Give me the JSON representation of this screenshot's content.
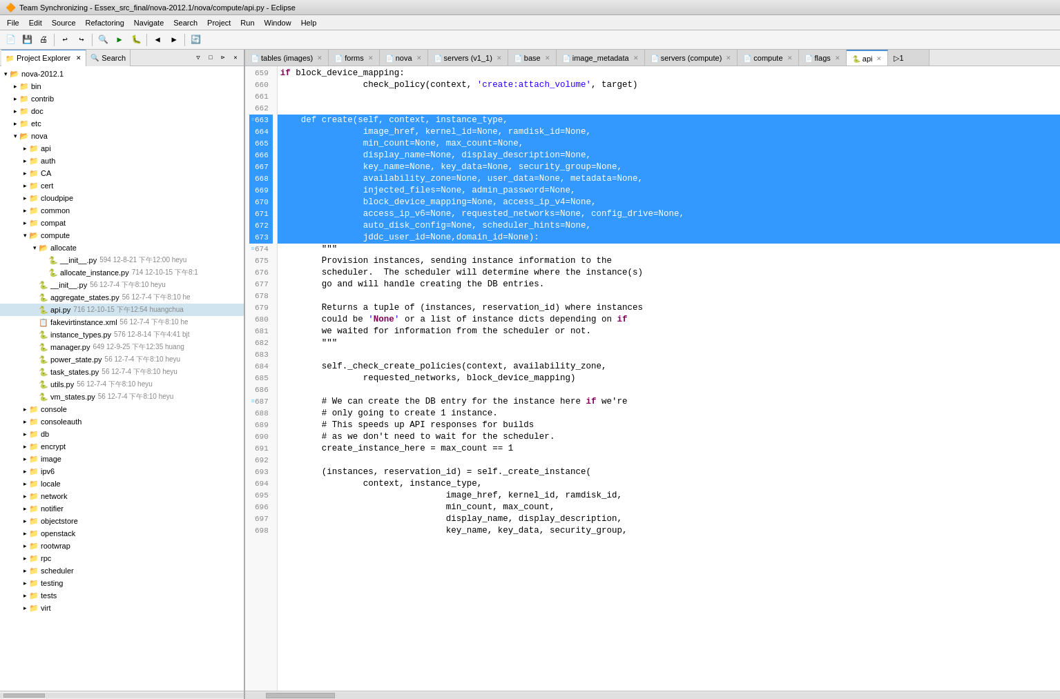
{
  "titleBar": {
    "title": "Team Synchronizing - Essex_src_final/nova-2012.1/nova/compute/api.py - Eclipse",
    "icon": "🔶"
  },
  "menuBar": {
    "items": [
      "File",
      "Edit",
      "Source",
      "Refactoring",
      "Navigate",
      "Search",
      "Project",
      "Run",
      "Window",
      "Help"
    ]
  },
  "leftPanel": {
    "tabs": [
      {
        "label": "Project Explorer",
        "icon": "📁",
        "active": true
      },
      {
        "label": "Search",
        "icon": "🔍",
        "active": false
      }
    ]
  },
  "fileTree": {
    "items": [
      {
        "label": "nova-2012.1",
        "type": "folder",
        "indent": 0,
        "expanded": true
      },
      {
        "label": "bin",
        "type": "folder",
        "indent": 1,
        "expanded": false
      },
      {
        "label": "contrib",
        "type": "folder",
        "indent": 1,
        "expanded": false
      },
      {
        "label": "doc",
        "type": "folder",
        "indent": 1,
        "expanded": false
      },
      {
        "label": "etc",
        "type": "folder",
        "indent": 1,
        "expanded": false
      },
      {
        "label": "nova",
        "type": "folder",
        "indent": 1,
        "expanded": true
      },
      {
        "label": "api",
        "type": "folder",
        "indent": 2,
        "expanded": false
      },
      {
        "label": "auth",
        "type": "folder",
        "indent": 2,
        "expanded": false
      },
      {
        "label": "CA",
        "type": "folder",
        "indent": 2,
        "expanded": false
      },
      {
        "label": "cert",
        "type": "folder",
        "indent": 2,
        "expanded": false
      },
      {
        "label": "cloudpipe",
        "type": "folder",
        "indent": 2,
        "expanded": false
      },
      {
        "label": "common",
        "type": "folder",
        "indent": 2,
        "expanded": false
      },
      {
        "label": "compat",
        "type": "folder",
        "indent": 2,
        "expanded": false
      },
      {
        "label": "compute",
        "type": "folder",
        "indent": 2,
        "expanded": true
      },
      {
        "label": "allocate",
        "type": "folder",
        "indent": 3,
        "expanded": true
      },
      {
        "label": "__init__.py",
        "type": "py",
        "indent": 4,
        "meta": "594  12-8-21  下午12:00  heyu"
      },
      {
        "label": "allocate_instance.py",
        "type": "py",
        "indent": 4,
        "meta": "714  12-10-15  下午8:1"
      },
      {
        "label": "__init__.py",
        "type": "py",
        "indent": 3,
        "meta": "56  12-7-4  下午8:10  heyu"
      },
      {
        "label": "aggregate_states.py",
        "type": "py",
        "indent": 3,
        "meta": "56  12-7-4  下午8:10  he"
      },
      {
        "label": "api.py",
        "type": "py",
        "indent": 3,
        "meta": "716  12-10-15  下午12:54  huangchua",
        "active": true
      },
      {
        "label": "fakevirtinstance.xml",
        "type": "xml",
        "indent": 3,
        "meta": "56  12-7-4  下午8:10  he"
      },
      {
        "label": "instance_types.py",
        "type": "py",
        "indent": 3,
        "meta": "576  12-8-14  下午4:41  bjt"
      },
      {
        "label": "manager.py",
        "type": "py",
        "indent": 3,
        "meta": "649  12-9-25  下午12:35  huang"
      },
      {
        "label": "power_state.py",
        "type": "py",
        "indent": 3,
        "meta": "56  12-7-4  下午8:10  heyu"
      },
      {
        "label": "task_states.py",
        "type": "py",
        "indent": 3,
        "meta": "56  12-7-4  下午8:10  heyu"
      },
      {
        "label": "utils.py",
        "type": "py",
        "indent": 3,
        "meta": "56  12-7-4  下午8:10  heyu"
      },
      {
        "label": "vm_states.py",
        "type": "py",
        "indent": 3,
        "meta": "56  12-7-4  下午8:10  heyu"
      },
      {
        "label": "console",
        "type": "folder",
        "indent": 2,
        "expanded": false
      },
      {
        "label": "consoleauth",
        "type": "folder",
        "indent": 2,
        "expanded": false
      },
      {
        "label": "db",
        "type": "folder",
        "indent": 2,
        "expanded": false
      },
      {
        "label": "encrypt",
        "type": "folder",
        "indent": 2,
        "expanded": false
      },
      {
        "label": "image",
        "type": "folder",
        "indent": 2,
        "expanded": false
      },
      {
        "label": "ipv6",
        "type": "folder",
        "indent": 2,
        "expanded": false
      },
      {
        "label": "locale",
        "type": "folder",
        "indent": 2,
        "expanded": false
      },
      {
        "label": "network",
        "type": "folder",
        "indent": 2,
        "expanded": false
      },
      {
        "label": "notifier",
        "type": "folder",
        "indent": 2,
        "expanded": false
      },
      {
        "label": "objectstore",
        "type": "folder",
        "indent": 2,
        "expanded": false
      },
      {
        "label": "openstack",
        "type": "folder",
        "indent": 2,
        "expanded": false
      },
      {
        "label": "rootwrap",
        "type": "folder",
        "indent": 2,
        "expanded": false
      },
      {
        "label": "rpc",
        "type": "folder",
        "indent": 2,
        "expanded": false
      },
      {
        "label": "scheduler",
        "type": "folder",
        "indent": 2,
        "expanded": false
      },
      {
        "label": "testing",
        "type": "folder",
        "indent": 2,
        "expanded": false
      },
      {
        "label": "tests",
        "type": "folder",
        "indent": 2,
        "expanded": false
      },
      {
        "label": "virt",
        "type": "folder",
        "indent": 2,
        "expanded": false
      }
    ]
  },
  "editorTabs": {
    "tabs": [
      {
        "label": "tables (images)",
        "icon": "📄",
        "active": false
      },
      {
        "label": "forms",
        "icon": "📄",
        "active": false
      },
      {
        "label": "nova",
        "icon": "📄",
        "active": false
      },
      {
        "label": "servers (v1_1)",
        "icon": "📄",
        "active": false
      },
      {
        "label": "base",
        "icon": "📄",
        "active": false
      },
      {
        "label": "image_metadata",
        "icon": "📄",
        "active": false
      },
      {
        "label": "servers (compute)",
        "icon": "📄",
        "active": false
      },
      {
        "label": "compute",
        "icon": "📄",
        "active": false
      },
      {
        "label": "flags",
        "icon": "📄",
        "active": false
      },
      {
        "label": "api",
        "icon": "📄",
        "active": true
      },
      {
        "label": "▷1",
        "icon": "",
        "active": false
      }
    ]
  },
  "codeLines": [
    {
      "num": "659",
      "content": "            if block_device_mapping:",
      "selected": false
    },
    {
      "num": "660",
      "content": "                check_policy(context, 'create:attach_volume', target)",
      "selected": false,
      "hasString": true
    },
    {
      "num": "661",
      "content": "",
      "selected": false
    },
    {
      "num": "662",
      "content": "",
      "selected": false
    },
    {
      "num": "663",
      "content": "    def create(self, context, instance_type,",
      "selected": true
    },
    {
      "num": "664",
      "content": "                image_href, kernel_id=None, ramdisk_id=None,",
      "selected": true
    },
    {
      "num": "665",
      "content": "                min_count=None, max_count=None,",
      "selected": true
    },
    {
      "num": "666",
      "content": "                display_name=None, display_description=None,",
      "selected": true
    },
    {
      "num": "667",
      "content": "                key_name=None, key_data=None, security_group=None,",
      "selected": true
    },
    {
      "num": "668",
      "content": "                availability_zone=None, user_data=None, metadata=None,",
      "selected": true
    },
    {
      "num": "669",
      "content": "                injected_files=None, admin_password=None,",
      "selected": true
    },
    {
      "num": "670",
      "content": "                block_device_mapping=None, access_ip_v4=None,",
      "selected": true
    },
    {
      "num": "671",
      "content": "                access_ip_v6=None, requested_networks=None, config_drive=None,",
      "selected": true
    },
    {
      "num": "672",
      "content": "                auto_disk_config=None, scheduler_hints=None,",
      "selected": true
    },
    {
      "num": "673",
      "content": "                jddc_user_id=None,domain_id=None):",
      "selected": true
    },
    {
      "num": "674",
      "content": "        \"\"\"",
      "selected": false,
      "isDocstring": true
    },
    {
      "num": "675",
      "content": "        Provision instances, sending instance information to the",
      "selected": false,
      "isDocstring": true
    },
    {
      "num": "676",
      "content": "        scheduler.  The scheduler will determine where the instance(s)",
      "selected": false,
      "isDocstring": true
    },
    {
      "num": "677",
      "content": "        go and will handle creating the DB entries.",
      "selected": false,
      "isDocstring": true
    },
    {
      "num": "678",
      "content": "",
      "selected": false
    },
    {
      "num": "679",
      "content": "        Returns a tuple of (instances, reservation_id) where instances",
      "selected": false,
      "isDocstring": true
    },
    {
      "num": "680",
      "content": "        could be 'None' or a list of instance dicts depending on if",
      "selected": false,
      "isDocstring": true
    },
    {
      "num": "681",
      "content": "        we waited for information from the scheduler or not.",
      "selected": false,
      "isDocstring": true
    },
    {
      "num": "682",
      "content": "        \"\"\"",
      "selected": false,
      "isDocstring": true
    },
    {
      "num": "683",
      "content": "",
      "selected": false
    },
    {
      "num": "684",
      "content": "        self._check_create_policies(context, availability_zone,",
      "selected": false
    },
    {
      "num": "685",
      "content": "                requested_networks, block_device_mapping)",
      "selected": false
    },
    {
      "num": "686",
      "content": "",
      "selected": false
    },
    {
      "num": "687",
      "content": "        # We can create the DB entry for the instance here if we're",
      "selected": false,
      "isComment": true
    },
    {
      "num": "688",
      "content": "        # only going to create 1 instance.",
      "selected": false,
      "isComment": true
    },
    {
      "num": "689",
      "content": "        # This speeds up API responses for builds",
      "selected": false,
      "isComment": true
    },
    {
      "num": "690",
      "content": "        # as we don't need to wait for the scheduler.",
      "selected": false,
      "isComment": true
    },
    {
      "num": "691",
      "content": "        create_instance_here = max_count == 1",
      "selected": false
    },
    {
      "num": "692",
      "content": "",
      "selected": false
    },
    {
      "num": "693",
      "content": "        (instances, reservation_id) = self._create_instance(",
      "selected": false
    },
    {
      "num": "694",
      "content": "                context, instance_type,",
      "selected": false
    },
    {
      "num": "695",
      "content": "                                image_href, kernel_id, ramdisk_id,",
      "selected": false
    },
    {
      "num": "696",
      "content": "                                min_count, max_count,",
      "selected": false
    },
    {
      "num": "697",
      "content": "                                display_name, display_description,",
      "selected": false
    },
    {
      "num": "698",
      "content": "                                key_name, key_data, security_group,",
      "selected": false
    }
  ]
}
